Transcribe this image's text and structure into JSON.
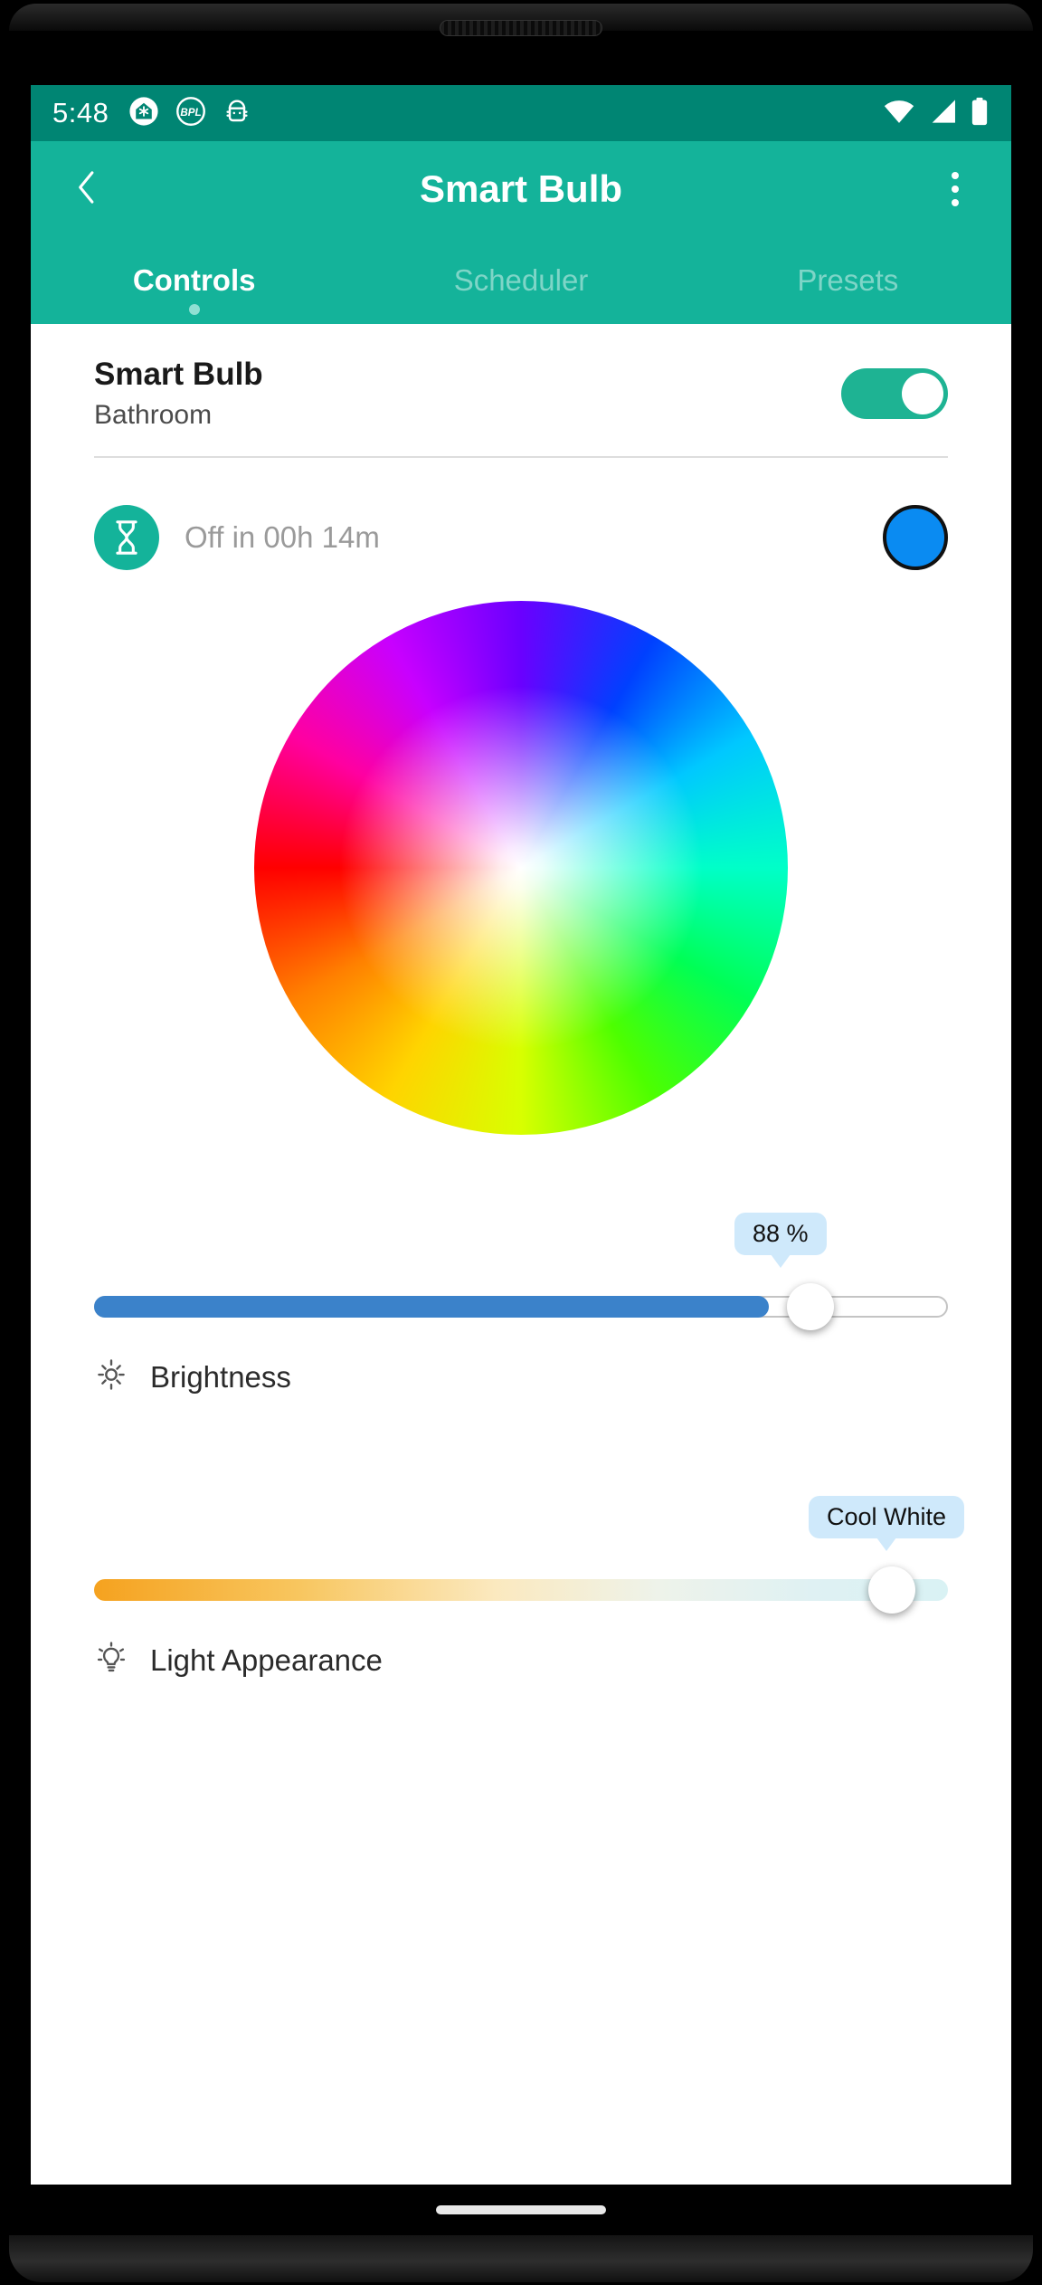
{
  "status_bar": {
    "time": "5:48",
    "left_icons": [
      "home-snowflake-icon",
      "bpl-logo-icon",
      "android-bot-icon"
    ],
    "right_icons": [
      "wifi-icon",
      "cell-signal-icon",
      "battery-icon"
    ]
  },
  "app_bar": {
    "title": "Smart Bulb",
    "back_icon": "chevron-left-icon",
    "overflow_icon": "overflow-menu-icon"
  },
  "tabs": [
    {
      "label": "Controls",
      "active": true
    },
    {
      "label": "Scheduler",
      "active": false
    },
    {
      "label": "Presets",
      "active": false
    }
  ],
  "device": {
    "name": "Smart Bulb",
    "room": "Bathroom",
    "power_on": true
  },
  "timer": {
    "icon": "hourglass-icon",
    "text": "Off in 00h 14m",
    "swatch_color": "#0a8bf2"
  },
  "color_wheel": {
    "name": "hsv-color-wheel"
  },
  "brightness": {
    "label": "Brightness",
    "icon": "sun-icon",
    "value_label": "88 %",
    "value": 88
  },
  "light_appearance": {
    "label": "Light Appearance",
    "icon": "lightbulb-icon",
    "value_label": "Cool White"
  },
  "colors": {
    "status_bar": "#008573",
    "app_bar": "#14b39a",
    "accent": "#14b39a",
    "slider_fill": "#3b82ca",
    "tooltip_bg": "#cfe9fb"
  }
}
